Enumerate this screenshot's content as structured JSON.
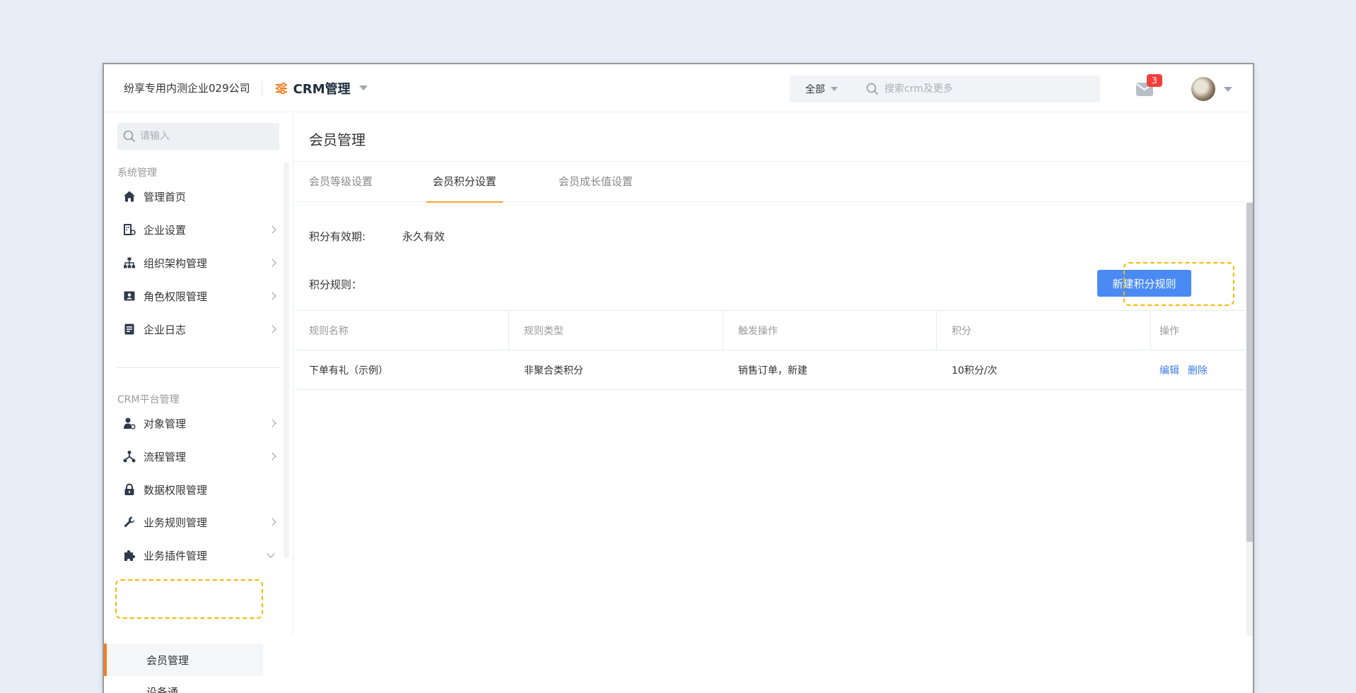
{
  "header": {
    "company": "纷享专用内测企业029公司",
    "app_title": "CRM管理",
    "search_scope": "全部",
    "search_placeholder": "搜索crm及更多",
    "notification_count": "3"
  },
  "sidebar": {
    "search_placeholder": "请输入",
    "group_system": "系统管理",
    "system_items": [
      {
        "label": "管理首页",
        "icon": "home-icon"
      },
      {
        "label": "企业设置",
        "icon": "building-gear-icon"
      },
      {
        "label": "组织架构管理",
        "icon": "org-chart-icon"
      },
      {
        "label": "角色权限管理",
        "icon": "id-card-icon"
      },
      {
        "label": "企业日志",
        "icon": "log-document-icon"
      }
    ],
    "group_crm": "CRM平台管理",
    "crm_items": [
      {
        "label": "对象管理",
        "icon": "user-gear-icon"
      },
      {
        "label": "流程管理",
        "icon": "flow-icon"
      },
      {
        "label": "数据权限管理",
        "icon": "lock-icon"
      },
      {
        "label": "业务规则管理",
        "icon": "wrench-icon"
      },
      {
        "label": "业务插件管理",
        "icon": "puzzle-icon"
      }
    ],
    "sub_items": [
      {
        "label": "会员管理"
      },
      {
        "label": "设备通"
      }
    ]
  },
  "main": {
    "page_title": "会员管理",
    "tabs": [
      {
        "label": "会员等级设置"
      },
      {
        "label": "会员积分设置"
      },
      {
        "label": "会员成长值设置"
      }
    ],
    "validity_label": "积分有效期:",
    "validity_value": "永久有效",
    "rules_label": "积分规则：",
    "new_rule_button": "新建积分规则",
    "table": {
      "columns": [
        "规则名称",
        "规则类型",
        "触发操作",
        "积分",
        "操作"
      ],
      "rows": [
        {
          "name": "下单有礼（示例）",
          "type": "非聚合类积分",
          "trigger": "销售订单，新建",
          "points": "10积分/次",
          "edit": "编辑",
          "delete": "删除"
        }
      ]
    }
  },
  "colors": {
    "accent": "#4a8af4",
    "active_tab_underline": "#f5a623",
    "active_sidebar_marker": "#f57c1f",
    "highlight_dashed": "#f5b800",
    "badge": "#f1403c",
    "link": "#3b7bea"
  }
}
